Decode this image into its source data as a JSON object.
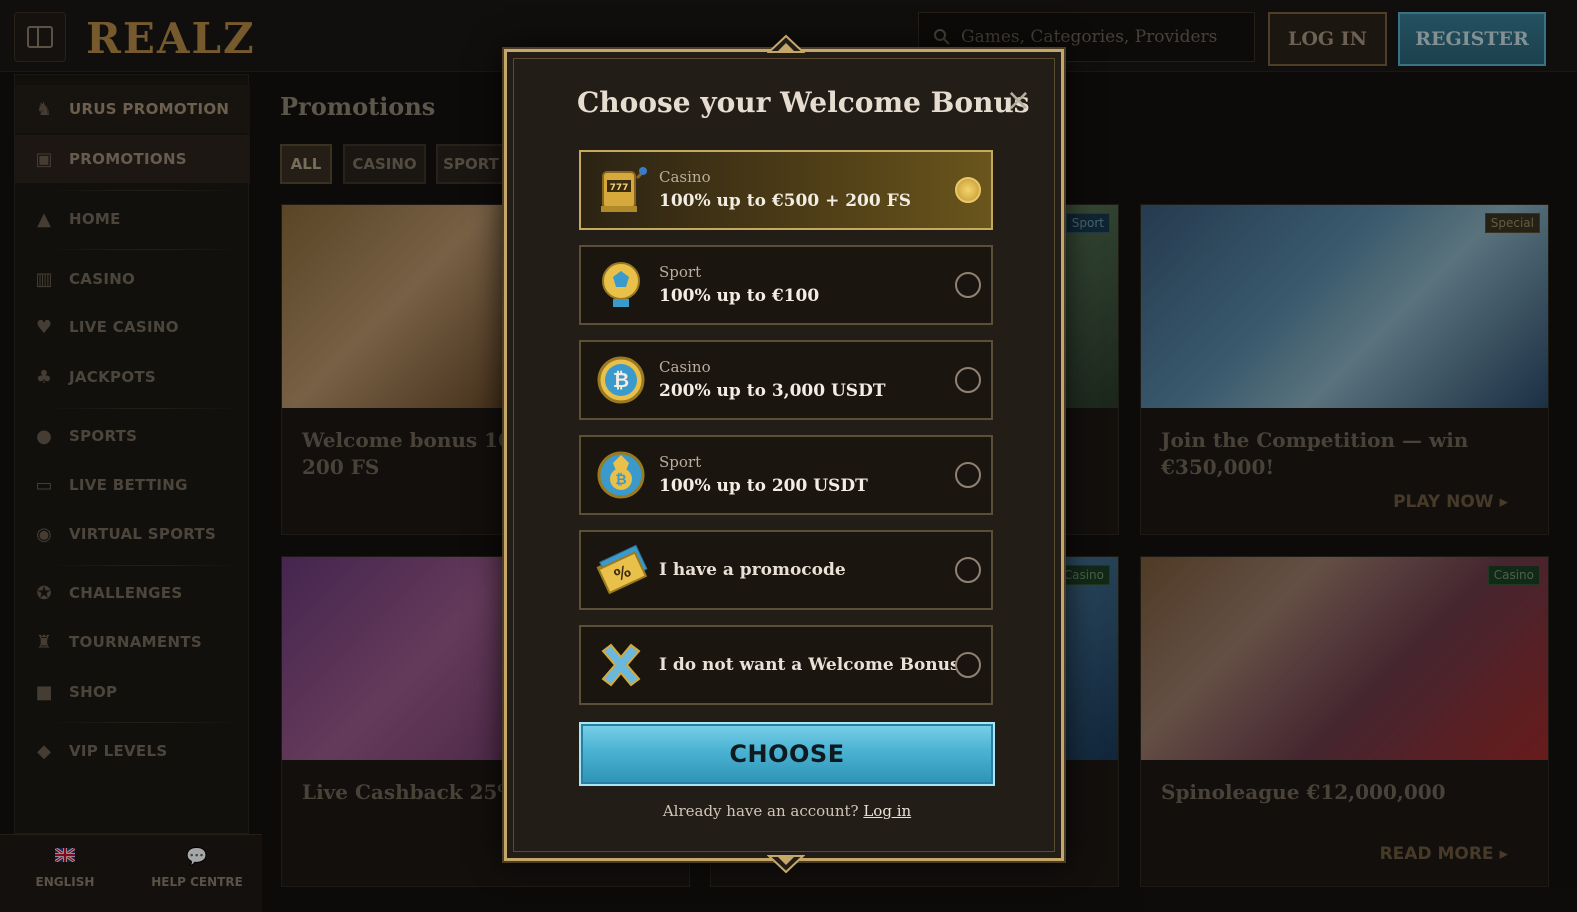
{
  "header": {
    "logo": "REALZ",
    "search_placeholder": "Games, Categories, Providers",
    "login_label": "LOG IN",
    "register_label": "REGISTER"
  },
  "sidebar": {
    "items": [
      {
        "label": "URUS PROMOTION",
        "icon": "car-emblem-icon"
      },
      {
        "label": "PROMOTIONS",
        "icon": "gift-icon"
      },
      {
        "label": "HOME",
        "icon": "pyramid-icon"
      },
      {
        "label": "CASINO",
        "icon": "slot-machine-icon"
      },
      {
        "label": "LIVE CASINO",
        "icon": "playing-card-icon"
      },
      {
        "label": "JACKPOTS",
        "icon": "clover-icon"
      },
      {
        "label": "SPORTS",
        "icon": "ball-icon"
      },
      {
        "label": "LIVE BETTING",
        "icon": "live-badge-icon"
      },
      {
        "label": "VIRTUAL SPORTS",
        "icon": "virtual-sports-icon"
      },
      {
        "label": "CHALLENGES",
        "icon": "challenge-icon"
      },
      {
        "label": "TOURNAMENTS",
        "icon": "trophy-icon"
      },
      {
        "label": "SHOP",
        "icon": "shop-icon"
      },
      {
        "label": "VIP LEVELS",
        "icon": "diamond-icon"
      }
    ],
    "bottom": {
      "language": "ENGLISH",
      "help": "HELP CENTRE"
    }
  },
  "main": {
    "title": "Promotions",
    "filters": [
      "ALL",
      "CASINO",
      "SPORT"
    ],
    "cards": [
      {
        "title": "Welcome bonus 100%\n200 FS",
        "tag": "",
        "cta": ""
      },
      {
        "title": "",
        "tag": "Sport",
        "cta": ""
      },
      {
        "title": "Join the Competition — win €350,000!",
        "tag": "Special",
        "cta": "PLAY NOW"
      },
      {
        "title": "Live Cashback 25% up",
        "tag": "",
        "cta": ""
      },
      {
        "title": "",
        "tag": "Casino",
        "cta": ""
      },
      {
        "title": "Spinoleague €12,000,000",
        "tag": "Casino",
        "cta": "READ MORE"
      }
    ]
  },
  "modal": {
    "title": "Choose your Welcome Bonus",
    "close": "×",
    "options": [
      {
        "category": "Casino",
        "value": "100% up to €500 + 200 FS",
        "icon": "slot-machine-icon",
        "selected": true
      },
      {
        "category": "Sport",
        "value": "100% up to €100",
        "icon": "soccer-ball-icon",
        "selected": false
      },
      {
        "category": "Casino",
        "value": "200% up to 3,000 USDT",
        "icon": "bitcoin-coin-icon",
        "selected": false
      },
      {
        "category": "Sport",
        "value": "100% up to 200 USDT",
        "icon": "bitcoin-ball-icon",
        "selected": false
      },
      {
        "category": "",
        "value": "I have a promocode",
        "icon": "promo-ticket-icon",
        "selected": false
      },
      {
        "category": "",
        "value": "I do not want a Welcome Bonus",
        "icon": "cross-icon",
        "selected": false
      }
    ],
    "choose_label": "CHOOSE",
    "already_text": "Already have an account?",
    "login_link": "Log in"
  },
  "colors": {
    "accent_gold": "#c7a95e",
    "accent_blue": "#4ab2d2",
    "background": "#141210"
  }
}
